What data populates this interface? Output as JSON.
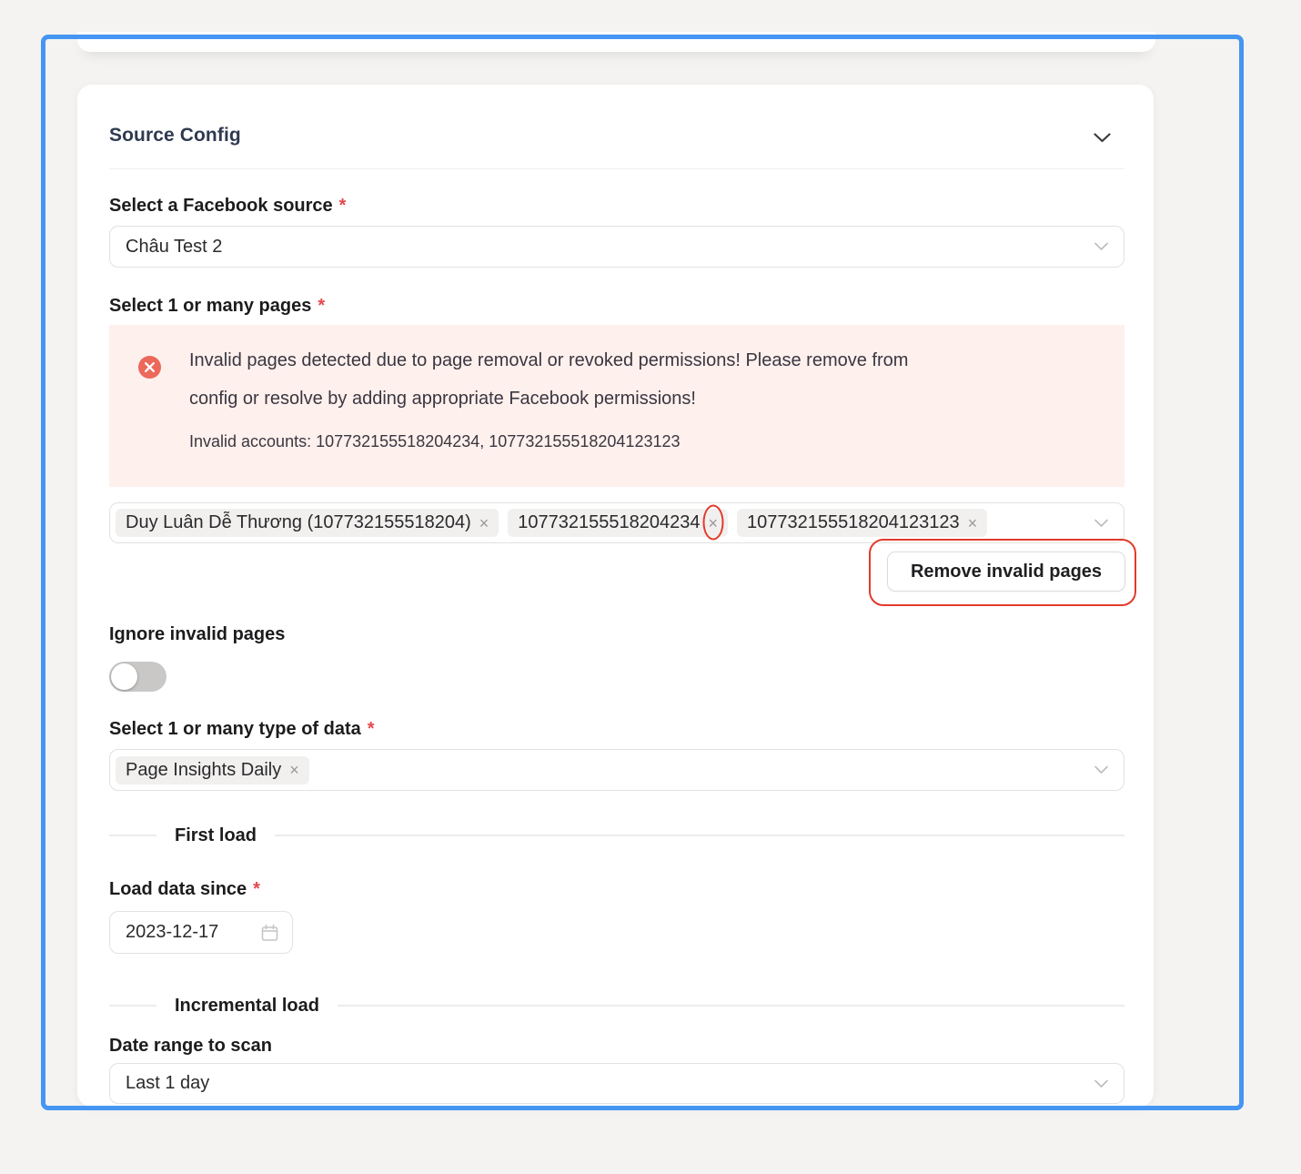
{
  "panel": {
    "title": "Source Config"
  },
  "source_field": {
    "label": "Select a Facebook source",
    "required_mark": "*",
    "value": "Châu Test 2"
  },
  "pages_field": {
    "label": "Select 1 or many pages",
    "required_mark": "*",
    "alert": {
      "lines": [
        "Invalid pages detected due to page removal or revoked permissions! Please remove from",
        "config or resolve by adding appropriate Facebook permissions!"
      ],
      "accounts": "Invalid accounts: 107732155518204234, 107732155518204123123"
    },
    "tags": [
      {
        "label": "Duy Luân Dễ Thương (107732155518204)"
      },
      {
        "label": "107732155518204234"
      },
      {
        "label": "107732155518204123123"
      }
    ],
    "close_glyph": "×",
    "remove_button_label": "Remove invalid pages"
  },
  "ignore_field": {
    "label": "Ignore invalid pages",
    "state": "off"
  },
  "data_type_field": {
    "label": "Select 1 or many type of data",
    "required_mark": "*",
    "tags": [
      {
        "label": "Page Insights Daily"
      }
    ],
    "close_glyph": "×"
  },
  "first_load_section": {
    "divider_label": "First load",
    "date_field": {
      "label": "Load data since",
      "required_mark": "*",
      "value": "2023-12-17"
    }
  },
  "incremental_section": {
    "divider_label": "Incremental load",
    "range_field": {
      "label": "Date range to scan",
      "value": "Last 1 day"
    }
  },
  "colors": {
    "selection_frame_blue": "#4595f2",
    "annotation_red": "#e23a2c",
    "alert_background": "#fdf0ed",
    "alert_icon_red": "#ec685a"
  }
}
